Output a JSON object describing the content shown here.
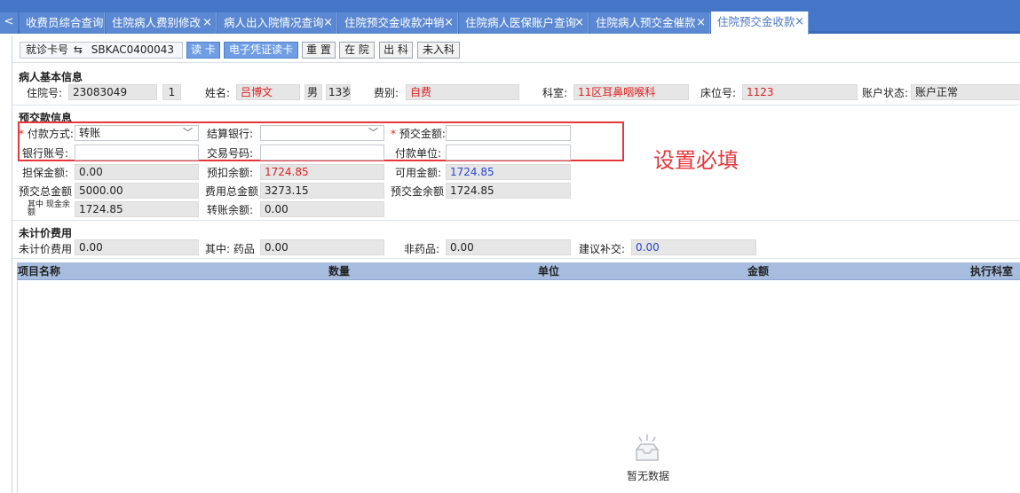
{
  "tabs": [
    {
      "label": "收费员综合查询",
      "closable": false,
      "active": false
    },
    {
      "label": "住院病人费别修改",
      "closable": true,
      "active": false
    },
    {
      "label": "病人出入院情况查询",
      "closable": true,
      "active": false
    },
    {
      "label": "住院预交金收款冲销",
      "closable": true,
      "active": false
    },
    {
      "label": "住院病人医保账户查询",
      "closable": true,
      "active": false
    },
    {
      "label": "住院病人预交金催款",
      "closable": true,
      "active": false
    },
    {
      "label": "住院预交金收款",
      "closable": true,
      "active": true
    }
  ],
  "nav_prev_glyph": "<",
  "close_glyph": "×",
  "toolbar": {
    "card_type": "就诊卡号",
    "card_number": "SBKAC0400043",
    "buttons": [
      "读 卡",
      "电子凭证读卡",
      "重 置",
      "在 院",
      "出 科",
      "未入科"
    ]
  },
  "patient": {
    "section_title": "病人基本信息",
    "inpatient_no_label": "住院号:",
    "inpatient_no": "23083049",
    "visit_count": "1",
    "name_label": "姓名:",
    "name": "吕博文",
    "gender": "男",
    "age": "13岁",
    "fee_type_label": "费别:",
    "fee_type": "自费",
    "dept_label": "科室:",
    "dept": "11区耳鼻咽喉科",
    "bed_label": "床位号:",
    "bed": "1123",
    "account_status_label": "账户状态:",
    "account_status": "账户正常"
  },
  "deposit": {
    "section_title": "预交款信息",
    "required_mark": "*",
    "pay_method_label": "付款方式:",
    "pay_method": "转账",
    "settle_bank_label": "结算银行:",
    "settle_bank": "",
    "amount_label": "预交金额:",
    "amount": "",
    "bank_account_label": "银行账号:",
    "bank_account": "",
    "trade_no_label": "交易号码:",
    "trade_no": "",
    "payer_label": "付款单位:",
    "payer": "",
    "guarantee_label": "担保金额:",
    "guarantee": "0.00",
    "prepay_balance_label": "预扣余额:",
    "prepay_balance": "1724.85",
    "available_label": "可用金额:",
    "available": "1724.85",
    "total_deposit_label": "预交总金额",
    "total_deposit": "5000.00",
    "total_fee_label": "费用总金额",
    "total_fee": "3273.15",
    "deposit_balance_label": "预交金余额",
    "deposit_balance": "1724.85",
    "cash_balance_label": "其中 现金余额",
    "cash_balance": "1724.85",
    "transfer_balance_label": "转账余额:",
    "transfer_balance": "0.00"
  },
  "unbilled": {
    "section_title": "未计价费用",
    "fee_label": "未计价费用",
    "fee": "0.00",
    "drug_label": "其中:  药品",
    "drug": "0.00",
    "non_drug_label": "非药品:",
    "non_drug": "0.00",
    "suggest_label": "建议补交:",
    "suggest": "0.00"
  },
  "annotation": {
    "text": "设置必填",
    "color": "#e8373c"
  },
  "grid": {
    "columns": [
      "项目名称",
      "数量",
      "单位",
      "金额",
      "执行科室"
    ],
    "empty_text": "暂无数据"
  },
  "colors": {
    "tab_bar": "#4477c8",
    "grid_header": "#a7bde0",
    "alert_red": "#e02020",
    "value_blue": "#2a43d8"
  }
}
